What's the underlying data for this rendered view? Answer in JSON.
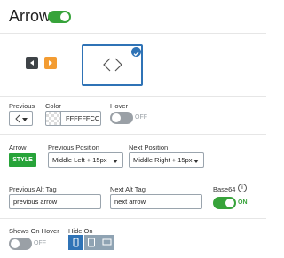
{
  "header": {
    "title": "Arrow",
    "toggle_on": true
  },
  "preview": {
    "left_button_icon": "triangle-left-icon",
    "right_button_icon": "triangle-right-icon",
    "left_button_color": "#3e4347",
    "right_button_color": "#f39c32",
    "selected_style_icon": "chevron-pair-icon",
    "check_icon": "check-circle-icon",
    "accent": "#2f73b6"
  },
  "row1": {
    "previous_label": "Previous",
    "previous_value_icon": "chevron-left-icon",
    "color_label": "Color",
    "color_value": "FFFFFFCC",
    "hover_label": "Hover",
    "hover_state": "OFF"
  },
  "row2": {
    "arrow_label": "Arrow",
    "style_button": "STYLE",
    "prev_position_label": "Previous Position",
    "prev_position_value": "Middle Left + 15px",
    "next_position_label": "Next Position",
    "next_position_value": "Middle Right + 15px"
  },
  "row3": {
    "prev_alt_label": "Previous Alt Tag",
    "prev_alt_value": "previous arrow",
    "next_alt_label": "Next Alt Tag",
    "next_alt_value": "next arrow",
    "base64_label": "Base64",
    "base64_state": "ON",
    "info_icon": "info-icon"
  },
  "row4": {
    "shows_on_hover_label": "Shows On Hover",
    "shows_on_hover_state": "OFF",
    "hide_on_label": "Hide On",
    "devices": [
      "phone-icon",
      "tablet-icon",
      "desktop-icon"
    ],
    "active_device_color": "#2f73b6",
    "device_color": "#8fa3b3"
  }
}
